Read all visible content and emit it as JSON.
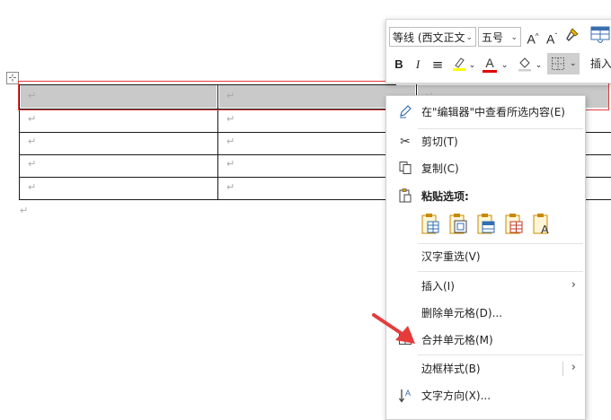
{
  "table": {
    "rows": [
      [
        "↵",
        "↵",
        "↵"
      ],
      [
        "↵",
        "↵",
        ""
      ],
      [
        "↵",
        "↵",
        ""
      ],
      [
        "↵",
        "↵",
        ""
      ],
      [
        "↵",
        "↵",
        ""
      ]
    ],
    "after_paragraph": "↵",
    "move_handle": "⊹"
  },
  "mini_toolbar": {
    "font_name": "等线 (西文正文",
    "font_size": "五号",
    "grow_font": "A^",
    "shrink_font": "Aˇ",
    "format_painter": "format-painter-icon",
    "bold": "B",
    "italic": "I",
    "center": "≡",
    "highlight_color": "#ffff00",
    "font_color": "A",
    "font_color_bar": "#e00000",
    "insert_label": "插入"
  },
  "context_menu": {
    "items": [
      {
        "id": "view-in-editor",
        "label": "在\"编辑器\"中查看所选内容(E)",
        "icon": "pen-icon"
      },
      {
        "id": "cut",
        "label": "剪切(T)",
        "icon": "scissors-icon"
      },
      {
        "id": "copy",
        "label": "复制(C)",
        "icon": "copy-icon"
      },
      {
        "id": "paste-options",
        "label": "粘贴选项:",
        "icon": "paste-icon"
      },
      {
        "id": "reconvert",
        "label": "汉字重选(V)",
        "icon": ""
      },
      {
        "id": "insert",
        "label": "插入(I)",
        "icon": ""
      },
      {
        "id": "delete-cells",
        "label": "删除单元格(D)...",
        "icon": ""
      },
      {
        "id": "merge-cells",
        "label": "合并单元格(M)",
        "icon": "merge-cells-icon"
      },
      {
        "id": "border-styles",
        "label": "边框样式(B)",
        "icon": ""
      },
      {
        "id": "text-direction",
        "label": "文字方向(X)...",
        "icon": "text-direction-icon"
      }
    ],
    "submenu_arrow": "›",
    "paste_icons": [
      "paste-keep-source-icon",
      "paste-nest-table-icon",
      "paste-merge-table-icon",
      "paste-overwrite-cells-icon",
      "paste-text-only-icon"
    ]
  },
  "colors": {
    "selection_outline": "#e53b3b",
    "arrow": "#e53b3b",
    "highlight_gray": "#c9c9c9"
  }
}
